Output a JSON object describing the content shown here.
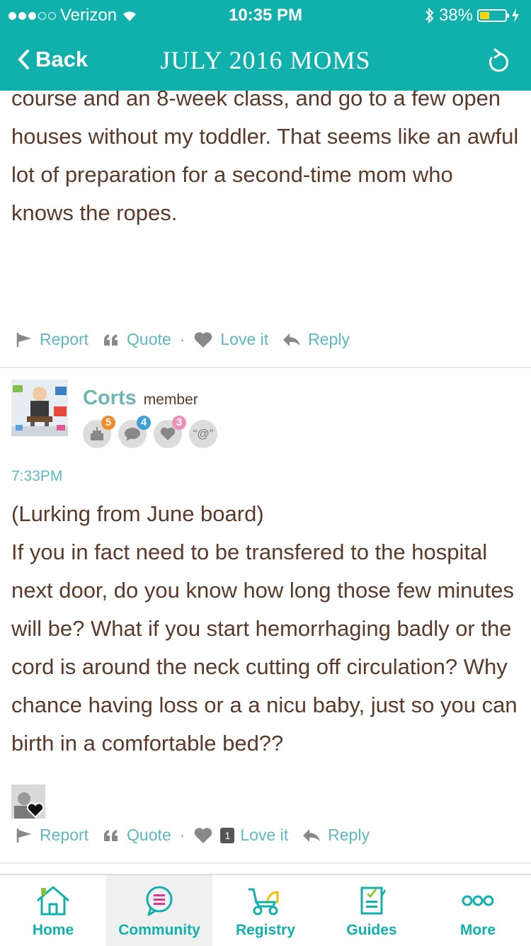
{
  "status": {
    "carrier": "Verizon",
    "time": "10:35 PM",
    "battery": "38%",
    "battery_level": 0.38
  },
  "nav": {
    "back_label": "Back",
    "title": "JULY 2016 MOMS"
  },
  "post1": {
    "text": "course and an 8-week class, and go to a few open houses without my toddler. That seems like an awful lot of preparation for a second-time mom who knows the ropes."
  },
  "actions": {
    "report": "Report",
    "quote": "Quote",
    "sep": "·",
    "love": "Love it",
    "reply": "Reply"
  },
  "post2": {
    "username": "Corts",
    "role": "member",
    "badges": [
      {
        "icon": "cake-icon",
        "count": "5",
        "color": "#f28c28"
      },
      {
        "icon": "comment-icon",
        "count": "4",
        "color": "#3fa0d8"
      },
      {
        "icon": "heart-icon",
        "count": "3",
        "color": "#f08fb8"
      },
      {
        "icon": "mention-icon",
        "label": "“@”"
      }
    ],
    "timestamp": "7:33PM",
    "text": "(Lurking from June board)\nIf you in fact need to be transfered to the hospital next door, do you know how long those few minutes will be? What if you start hemorrhaging badly or the cord is around the neck cutting off circulation? Why chance having loss or a a nicu baby, just so you can birth in a comfortable bed??",
    "love_count": "1"
  },
  "tabs": [
    {
      "label": "Home",
      "icon": "home-icon"
    },
    {
      "label": "Community",
      "icon": "community-icon",
      "active": true
    },
    {
      "label": "Registry",
      "icon": "stroller-icon"
    },
    {
      "label": "Guides",
      "icon": "guides-icon"
    },
    {
      "label": "More",
      "icon": "more-icon"
    }
  ]
}
